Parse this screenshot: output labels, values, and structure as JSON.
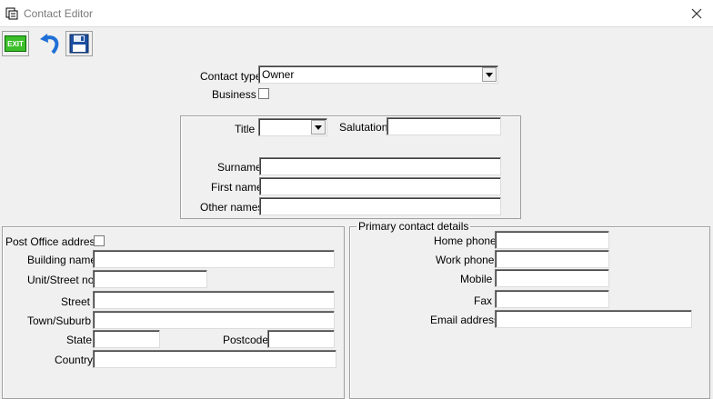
{
  "window": {
    "title": "Contact Editor"
  },
  "toolbar": {
    "exit_label": "EXIT"
  },
  "contact": {
    "type_label": "Contact type",
    "type_value": "Owner",
    "business_label": "Business"
  },
  "name_group": {
    "title_label": "Title",
    "title_value": "",
    "salutation_label": "Salutation",
    "salutation_value": "",
    "surname_label": "Surname",
    "surname_value": "",
    "first_name_label": "First name",
    "first_name_value": "",
    "other_names_label": "Other names",
    "other_names_value": ""
  },
  "address": {
    "po_label": "Post Office address",
    "building_label": "Building name",
    "building_value": "",
    "unit_label": "Unit/Street no.",
    "unit_value": "",
    "street_label": "Street",
    "street_value": "",
    "town_label": "Town/Suburb",
    "town_value": "",
    "state_label": "State",
    "state_value": "",
    "postcode_label": "Postcode",
    "postcode_value": "",
    "country_label": "Country",
    "country_value": ""
  },
  "primary_contact": {
    "legend": "Primary contact details",
    "home_label": "Home phone",
    "home_value": "",
    "work_label": "Work phone",
    "work_value": "",
    "mobile_label": "Mobile",
    "mobile_value": "",
    "fax_label": "Fax",
    "fax_value": "",
    "email_label": "Email address",
    "email_value": ""
  },
  "colors": {
    "background": "#f0f0f0",
    "titlebar": "#ffffff",
    "title_text": "#7a7a7a",
    "exit_green": "#3cbf2a",
    "undo_blue": "#1f6fd6",
    "save_blue": "#1d4fa0"
  }
}
